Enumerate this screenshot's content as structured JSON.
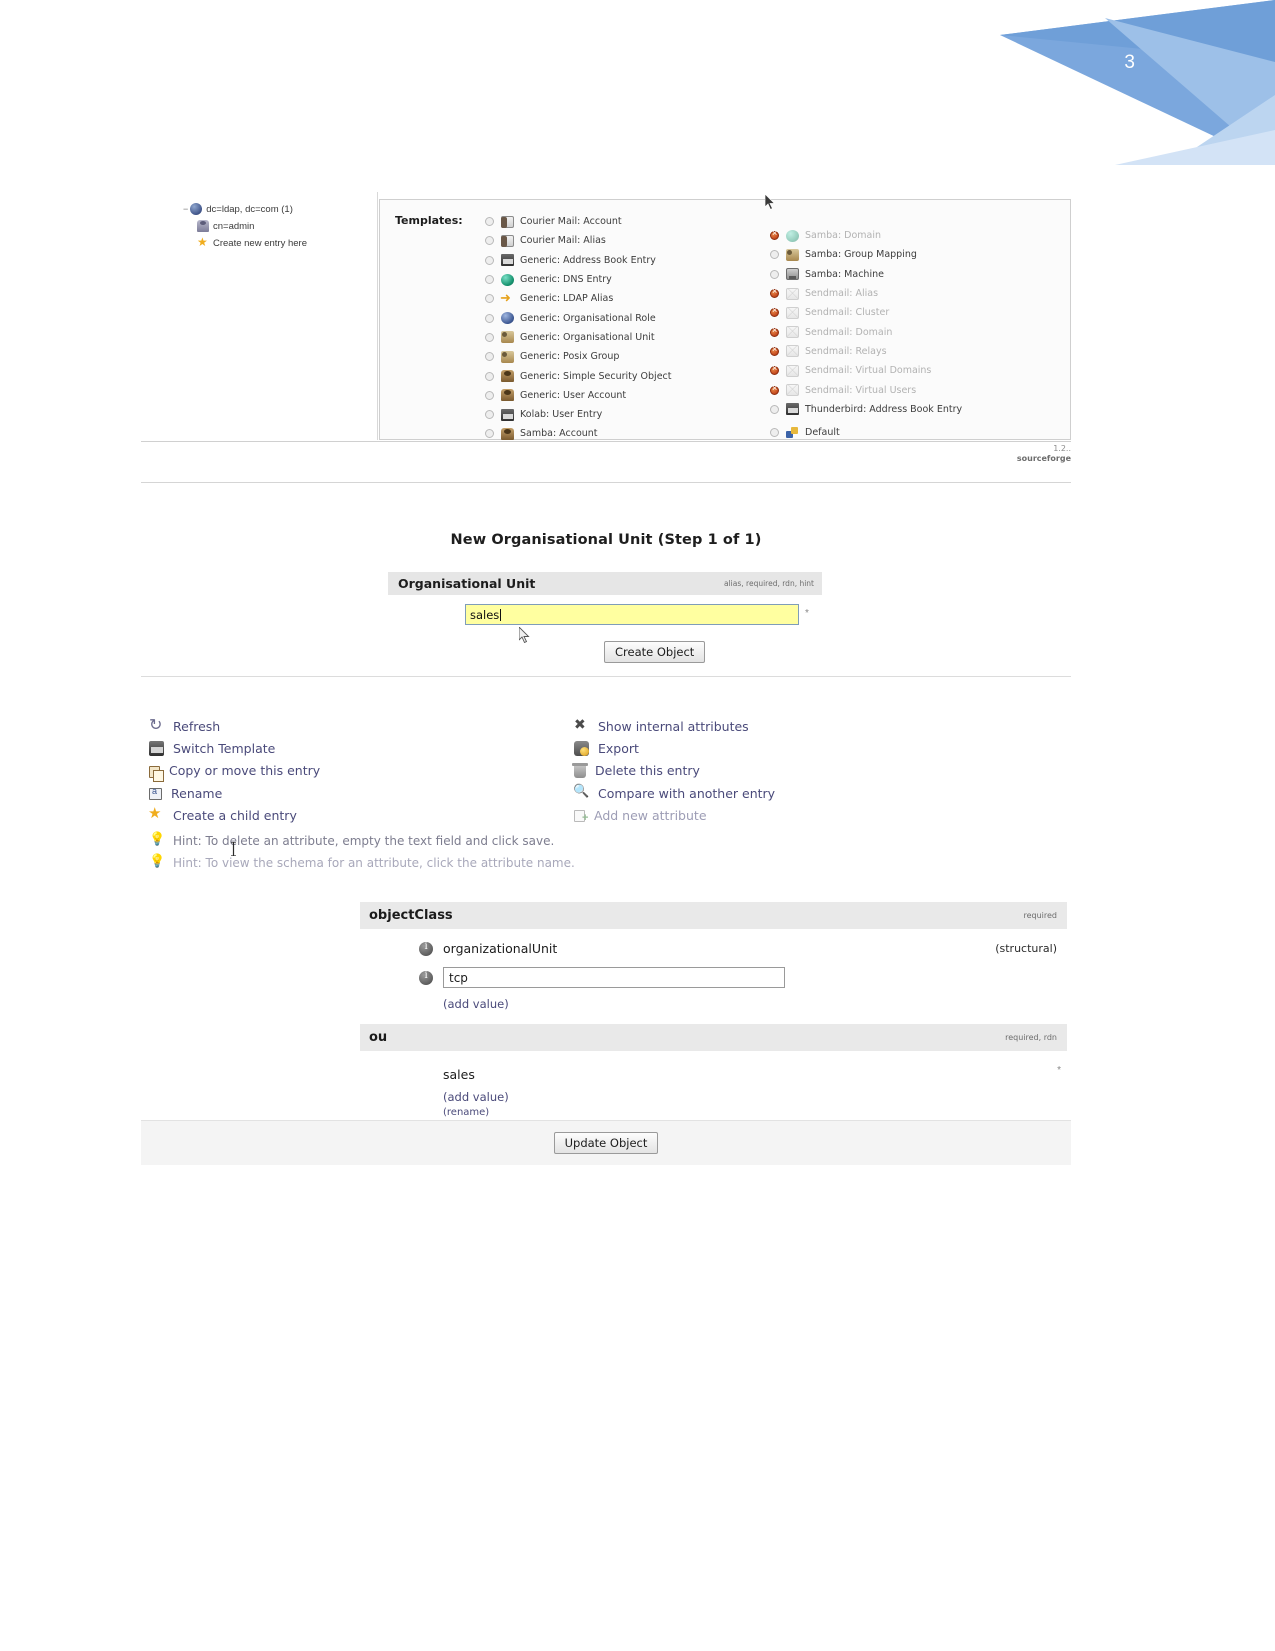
{
  "page": {
    "number": "3"
  },
  "figure_templates": {
    "tree": {
      "root": {
        "label": "dc=ldap, dc=com  (1)",
        "icon": "globe-icon",
        "expander": "−"
      },
      "children": [
        {
          "label": "cn=admin",
          "icon": "person-icon"
        },
        {
          "label": "Create new entry here",
          "icon": "star-icon"
        }
      ]
    },
    "templates_label": "Templates:",
    "left_column": [
      {
        "label": "Courier Mail: Account",
        "icon": "mail-account-icon",
        "enabled": true
      },
      {
        "label": "Courier Mail: Alias",
        "icon": "mail-alias-icon",
        "enabled": true
      },
      {
        "label": "Generic: Address Book Entry",
        "icon": "address-book-icon",
        "enabled": true
      },
      {
        "label": "Generic: DNS Entry",
        "icon": "dns-globe-icon",
        "enabled": true
      },
      {
        "label": "Generic: LDAP Alias",
        "icon": "arrow-icon",
        "enabled": true
      },
      {
        "label": "Generic: Organisational Role",
        "icon": "role-globe-icon",
        "enabled": true
      },
      {
        "label": "Generic: Organisational Unit",
        "icon": "group-icon",
        "enabled": true
      },
      {
        "label": "Generic: Posix Group",
        "icon": "group-icon",
        "enabled": true
      },
      {
        "label": "Generic: Simple Security Object",
        "icon": "user-icon",
        "enabled": true
      },
      {
        "label": "Generic: User Account",
        "icon": "user-icon",
        "enabled": true
      },
      {
        "label": "Kolab: User Entry",
        "icon": "address-book-icon",
        "enabled": true
      },
      {
        "label": "Samba: Account",
        "icon": "user-icon",
        "enabled": true
      }
    ],
    "right_column": [
      {
        "label": "Samba: Domain",
        "icon": "dns-globe-icon",
        "enabled": false
      },
      {
        "label": "Samba: Group Mapping",
        "icon": "group-icon",
        "enabled": true
      },
      {
        "label": "Samba: Machine",
        "icon": "machine-icon",
        "enabled": true
      },
      {
        "label": "Sendmail: Alias",
        "icon": "mail-icon",
        "enabled": false
      },
      {
        "label": "Sendmail: Cluster",
        "icon": "mail-icon",
        "enabled": false
      },
      {
        "label": "Sendmail: Domain",
        "icon": "mail-icon",
        "enabled": false
      },
      {
        "label": "Sendmail: Relays",
        "icon": "mail-icon",
        "enabled": false
      },
      {
        "label": "Sendmail: Virtual Domains",
        "icon": "mail-icon",
        "enabled": false
      },
      {
        "label": "Sendmail: Virtual Users",
        "icon": "mail-icon",
        "enabled": false
      },
      {
        "label": "Thunderbird: Address Book Entry",
        "icon": "address-book-icon",
        "enabled": true
      },
      {
        "label": "Default",
        "icon": "default-icon",
        "enabled": true
      }
    ],
    "credit": {
      "version": "1.2..",
      "source": "sourceforge"
    }
  },
  "figure_form": {
    "title": "New Organisational Unit (Step 1 of 1)",
    "header": {
      "name": "Organisational Unit",
      "flags": "alias, required, rdn, hint"
    },
    "input": {
      "value": "sales",
      "placeholder": ""
    },
    "required_mark": "*",
    "create_button": "Create Object"
  },
  "figure_entry": {
    "actions_left": [
      {
        "label": "Refresh",
        "icon": "refresh-icon",
        "dim": false
      },
      {
        "label": "Switch Template",
        "icon": "switch-template-icon",
        "dim": false
      },
      {
        "label": "Copy or move this entry",
        "icon": "copy-icon",
        "dim": false
      },
      {
        "label": "Rename",
        "icon": "rename-icon",
        "dim": false
      },
      {
        "label": "Create a child entry",
        "icon": "star-icon",
        "dim": false
      }
    ],
    "actions_right": [
      {
        "label": "Show internal attributes",
        "icon": "scissors-icon",
        "dim": false
      },
      {
        "label": "Export",
        "icon": "export-icon",
        "dim": false
      },
      {
        "label": "Delete this entry",
        "icon": "trash-icon",
        "dim": false
      },
      {
        "label": "Compare with another entry",
        "icon": "magnifier-icon",
        "dim": false
      },
      {
        "label": "Add new attribute",
        "icon": "add-attribute-icon",
        "dim": true
      }
    ],
    "hints": [
      {
        "text": "Hint: To delete an attribute, empty the text field and click save.",
        "icon": "lightbulb-icon",
        "faint": false
      },
      {
        "text": "Hint: To view the schema for an attribute, click the attribute name.",
        "icon": "lightbulb-icon",
        "faint": true
      }
    ],
    "attributes": [
      {
        "name": "objectClass",
        "flags": "required",
        "values": [
          {
            "text": "organizationalUnit",
            "type": "static",
            "note": "(structural)"
          },
          {
            "text": "tcp",
            "type": "input",
            "note": ""
          }
        ],
        "add_value": "(add value)",
        "rename": ""
      },
      {
        "name": "ou",
        "flags": "required, rdn",
        "values": [
          {
            "text": "sales",
            "type": "static",
            "note": "*"
          }
        ],
        "add_value": "(add value)",
        "rename": "(rename)"
      }
    ],
    "update_button": "Update Object"
  }
}
